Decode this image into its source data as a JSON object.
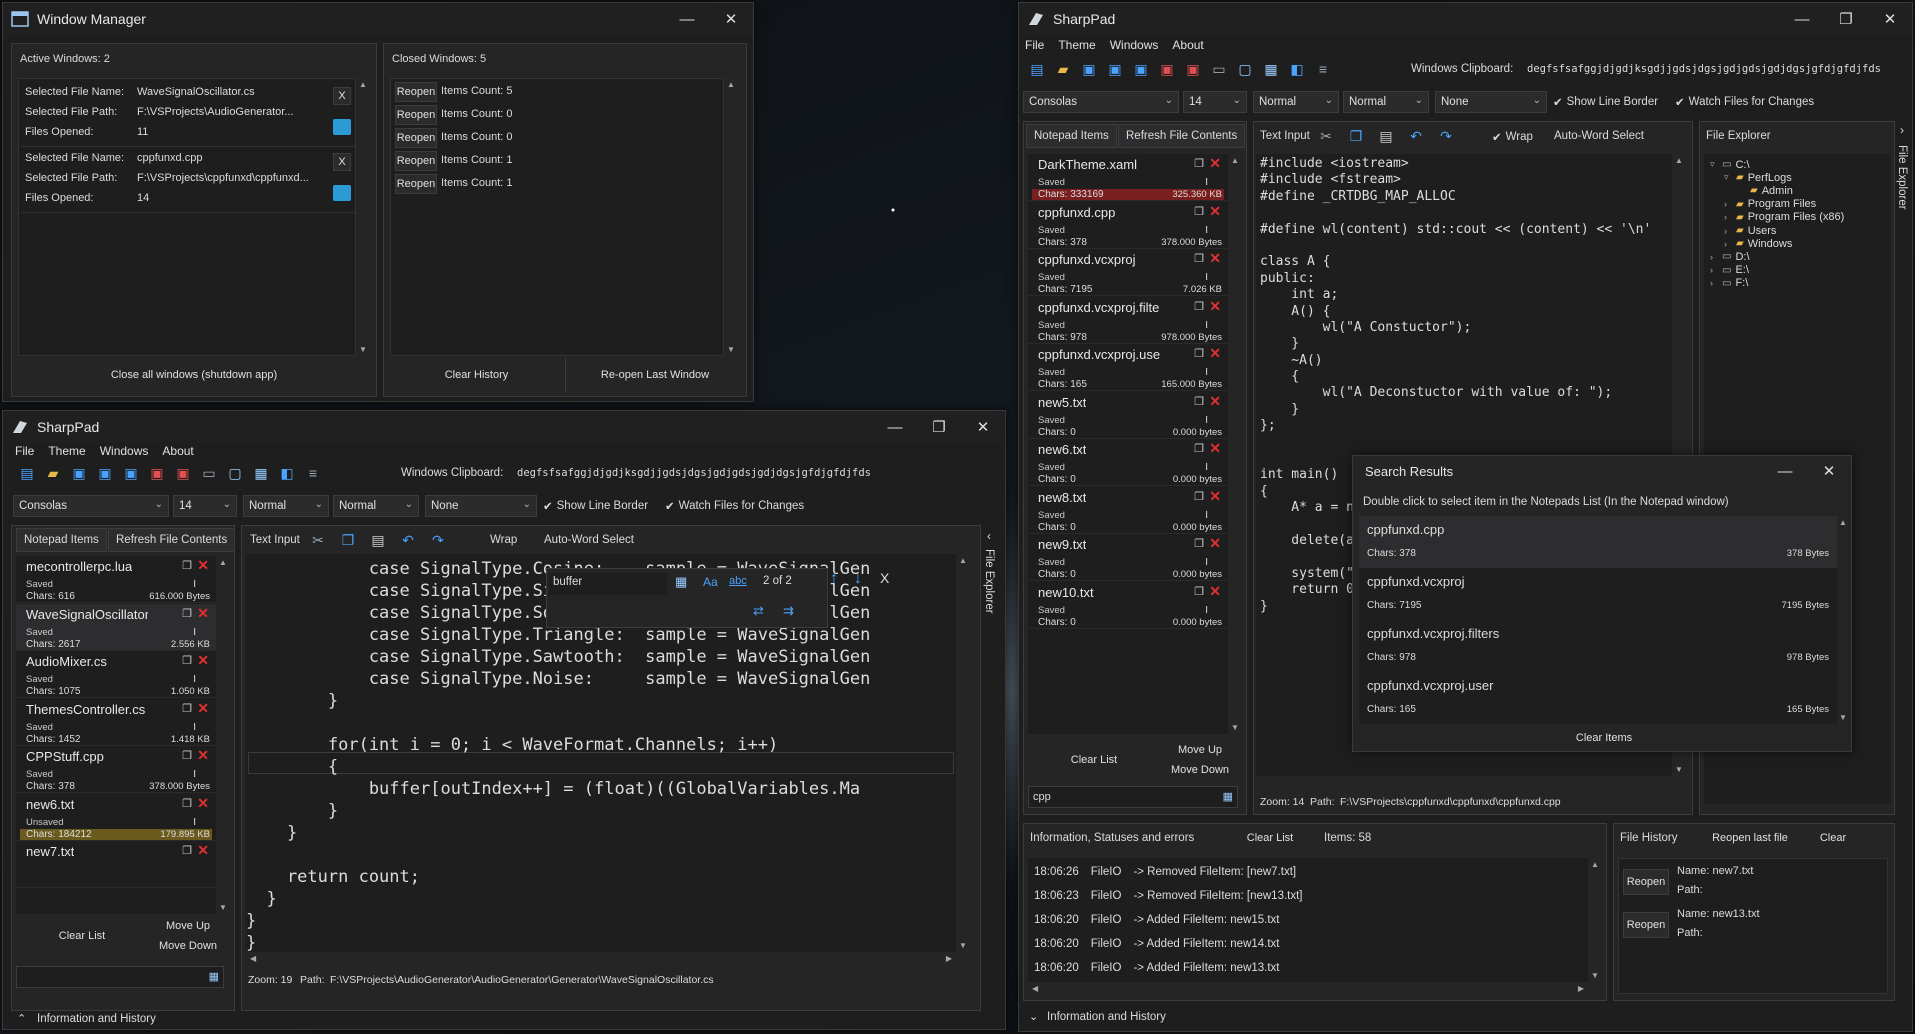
{
  "wm": {
    "title": "Window Manager",
    "active_label": "Active Windows: 2",
    "closed_label": "Closed Windows: 5",
    "active": [
      {
        "name_k": "Selected File Name:",
        "name_v": "WaveSignalOscillator.cs",
        "path_k": "Selected File Path:",
        "path_v": "F:\\VSProjects\\AudioGenerator...",
        "opened_k": "Files Opened:",
        "opened_v": "11"
      },
      {
        "name_k": "Selected File Name:",
        "name_v": "cppfunxd.cpp",
        "path_k": "Selected File Path:",
        "path_v": "F:\\VSProjects\\cppfunxd\\cppfunxd...",
        "opened_k": "Files Opened:",
        "opened_v": "14"
      }
    ],
    "closed": [
      {
        "btn": "Reopen",
        "text": "Items Count: 5"
      },
      {
        "btn": "Reopen",
        "text": "Items Count: 0"
      },
      {
        "btn": "Reopen",
        "text": "Items Count: 0"
      },
      {
        "btn": "Reopen",
        "text": "Items Count: 1"
      },
      {
        "btn": "Reopen",
        "text": "Items Count: 1"
      }
    ],
    "close_all": "Close all windows (shutdown app)",
    "clear_history": "Clear History",
    "reopen_last": "Re-open Last Window",
    "x": "X"
  },
  "menu": [
    "File",
    "Theme",
    "Windows",
    "About"
  ],
  "clipboard_label": "Windows Clipboard:",
  "clipboard_value": "degfsfsafggjdjgdjksgdjjgdsjdgsjgdjgdsjgdjdgsjgfdjgfdjfds",
  "clipboard_value2": "degfsfsafggjdjgdjksgdjjgdsjdgsjgdjgdsjgdjdgsjgfdjgfdjfds",
  "w1": {
    "title": "SharpPad",
    "font": "Consolas",
    "size": "14",
    "w1": "Normal",
    "w2": "Normal",
    "w3": "None",
    "show_border": "Show Line Border",
    "watch": "Watch Files for Changes",
    "tab_notepad": "Notepad Items",
    "tab_refresh": "Refresh File Contents",
    "text_input": "Text Input",
    "wrap": "Wrap",
    "autoword": "Auto-Word Select",
    "notepads": [
      {
        "n": "mecontrollerpc.lua",
        "s": "Saved",
        "c": "Chars: 616",
        "b": "616.000 Bytes"
      },
      {
        "n": "WaveSignalOscillator.cs",
        "s": "Saved",
        "c": "Chars: 2617",
        "b": "2.556 KB"
      },
      {
        "n": "AudioMixer.cs",
        "s": "Saved",
        "c": "Chars: 1075",
        "b": "1.050 KB"
      },
      {
        "n": "ThemesController.cs",
        "s": "Saved",
        "c": "Chars: 1452",
        "b": "1.418 KB"
      },
      {
        "n": "CPPStuff.cpp",
        "s": "Saved",
        "c": "Chars: 378",
        "b": "378.000 Bytes"
      },
      {
        "n": "new6.txt",
        "s": "Unsaved",
        "c": "Chars: 184212",
        "b": "179.895 KB"
      },
      {
        "n": "new7.txt",
        "s": "",
        "c": "",
        "b": ""
      }
    ],
    "clear_list": "Clear List",
    "move_up": "Move Up",
    "move_down": "Move Down",
    "find": {
      "text": "buffer",
      "aa": "Aa",
      "abc": "abc",
      "count": "2 of 2",
      "x": "X"
    },
    "code": [
      "            case SignalType.Cosine:    sample = WaveSignalGen",
      "            case SignalType.Sine:      sample = WaveSignalGen",
      "            case SignalType.Square:    sample = WaveSignalGen",
      "            case SignalType.Triangle:  sample = WaveSignalGen",
      "            case SignalType.Sawtooth:  sample = WaveSignalGen",
      "            case SignalType.Noise:     sample = WaveSignalGen",
      "        }",
      "",
      "        for(int i = 0; i < WaveFormat.Channels; i++)",
      "        {",
      "            buffer[outIndex++] = (float)((GlobalVariables.Ma",
      "        }",
      "    }",
      "",
      "    return count;",
      "  }",
      "}",
      "}"
    ],
    "status_zoom": "Zoom: 19",
    "status_path_k": "Path:",
    "status_path": "F:\\VSProjects\\AudioGenerator\\AudioGenerator\\Generator\\WaveSignalOscillator.cs",
    "info": "Information and History",
    "file_explorer": "File Explorer"
  },
  "w2": {
    "title": "SharpPad",
    "font": "Consolas",
    "size": "14",
    "w1": "Normal",
    "w2": "Normal",
    "w3": "None",
    "show_border": "Show Line Border",
    "watch": "Watch Files for Changes",
    "tab_notepad": "Notepad Items",
    "tab_refresh": "Refresh File Contents",
    "text_input": "Text Input",
    "wrap": "Wrap",
    "autoword": "Auto-Word Select",
    "notepads": [
      {
        "n": "DarkTheme.xaml",
        "s": "Saved",
        "c": "Chars: 333169",
        "b": "325.360 KB"
      },
      {
        "n": "cppfunxd.cpp",
        "s": "Saved",
        "c": "Chars: 378",
        "b": "378.000 Bytes"
      },
      {
        "n": "cppfunxd.vcxproj",
        "s": "Saved",
        "c": "Chars: 7195",
        "b": "7.026 KB"
      },
      {
        "n": "cppfunxd.vcxproj.filters",
        "s": "Saved",
        "c": "Chars: 978",
        "b": "978.000 Bytes"
      },
      {
        "n": "cppfunxd.vcxproj.user",
        "s": "Saved",
        "c": "Chars: 165",
        "b": "165.000 Bytes"
      },
      {
        "n": "new5.txt",
        "s": "Saved",
        "c": "Chars: 0",
        "b": "0.000 bytes"
      },
      {
        "n": "new6.txt",
        "s": "Saved",
        "c": "Chars: 0",
        "b": "0.000 bytes"
      },
      {
        "n": "new8.txt",
        "s": "Saved",
        "c": "Chars: 0",
        "b": "0.000 bytes"
      },
      {
        "n": "new9.txt",
        "s": "Saved",
        "c": "Chars: 0",
        "b": "0.000 bytes"
      },
      {
        "n": "new10.txt",
        "s": "Saved",
        "c": "Chars: 0",
        "b": "0.000 bytes"
      }
    ],
    "clear_list": "Clear List",
    "move_up": "Move Up",
    "move_down": "Move Down",
    "search_value": "cpp",
    "code": [
      "#include <iostream>",
      "#include <fstream>",
      "#define _CRTDBG_MAP_ALLOC",
      "",
      "#define wl(content) std::cout << (content) << '\\n'",
      "",
      "class A {",
      "public:",
      "    int a;",
      "    A() {",
      "        wl(\"A Constuctor\");",
      "    }",
      "    ~A()",
      "    {",
      "        wl(\"A Deconstuctor with value of: \");",
      "    }",
      "};",
      "",
      "",
      "int main()",
      "{",
      "    A* a = n",
      "",
      "    delete(a",
      "",
      "    system(\"",
      "    return 0",
      "}"
    ],
    "status_zoom": "Zoom: 14",
    "status_path_k": "Path:",
    "status_path": "F:\\VSProjects\\cppfunxd\\cppfunxd\\cppfunxd.cpp",
    "file_explorer": "File Explorer",
    "file_explorer_side": "File Explorer",
    "tree": [
      {
        "t": "C:\\",
        "d": 1,
        "e": "▿"
      },
      {
        "t": "PerfLogs",
        "d": 2,
        "e": "▿"
      },
      {
        "t": "Admin",
        "d": 3,
        "e": ""
      },
      {
        "t": "Program Files",
        "d": 2,
        "e": "›"
      },
      {
        "t": "Program Files (x86)",
        "d": 2,
        "e": "›"
      },
      {
        "t": "Users",
        "d": 2,
        "e": "›"
      },
      {
        "t": "Windows",
        "d": 2,
        "e": "›"
      },
      {
        "t": "D:\\",
        "d": 1,
        "e": "›"
      },
      {
        "t": "E:\\",
        "d": 1,
        "e": "›"
      },
      {
        "t": "F:\\",
        "d": 1,
        "e": "›"
      }
    ],
    "search": {
      "title": "Search Results",
      "hint": "Double click to select item in the Notepads List (In the Notepad window)",
      "items": [
        {
          "n": "cppfunxd.cpp",
          "c": "Chars: 378",
          "b": "378 Bytes"
        },
        {
          "n": "cppfunxd.vcxproj",
          "c": "Chars: 7195",
          "b": "7195 Bytes"
        },
        {
          "n": "cppfunxd.vcxproj.filters",
          "c": "Chars: 978",
          "b": "978 Bytes"
        },
        {
          "n": "cppfunxd.vcxproj.user",
          "c": "Chars: 165",
          "b": "165 Bytes"
        }
      ],
      "clear": "Clear Items"
    },
    "info": {
      "title": "Information, Statuses and errors",
      "clear": "Clear List",
      "count": "Items: 58",
      "rows": [
        {
          "t": "18:06:26",
          "s": "FileIO",
          "m": "-> Removed FileItem: [new7.txt]"
        },
        {
          "t": "18:06:23",
          "s": "FileIO",
          "m": "-> Removed FileItem: [new13.txt]"
        },
        {
          "t": "18:06:20",
          "s": "FileIO",
          "m": "-> Added FileItem: new15.txt"
        },
        {
          "t": "18:06:20",
          "s": "FileIO",
          "m": "-> Added FileItem: new14.txt"
        },
        {
          "t": "18:06:20",
          "s": "FileIO",
          "m": "-> Added FileItem: new13.txt"
        }
      ]
    },
    "history": {
      "title": "File History",
      "reopen_last": "Reopen last file",
      "clear": "Clear",
      "items": [
        {
          "btn": "Reopen",
          "name": "Name: new7.txt",
          "path": "Path:"
        },
        {
          "btn": "Reopen",
          "name": "Name: new13.txt",
          "path": "Path:"
        }
      ]
    },
    "info_footer": "Information and History"
  },
  "colors": {
    "accent": "#3c8ce7",
    "close_red": "#e03030",
    "selection": "#264f78",
    "unsaved": "#6b5a1e",
    "danger_row": "#7a1f1f"
  }
}
